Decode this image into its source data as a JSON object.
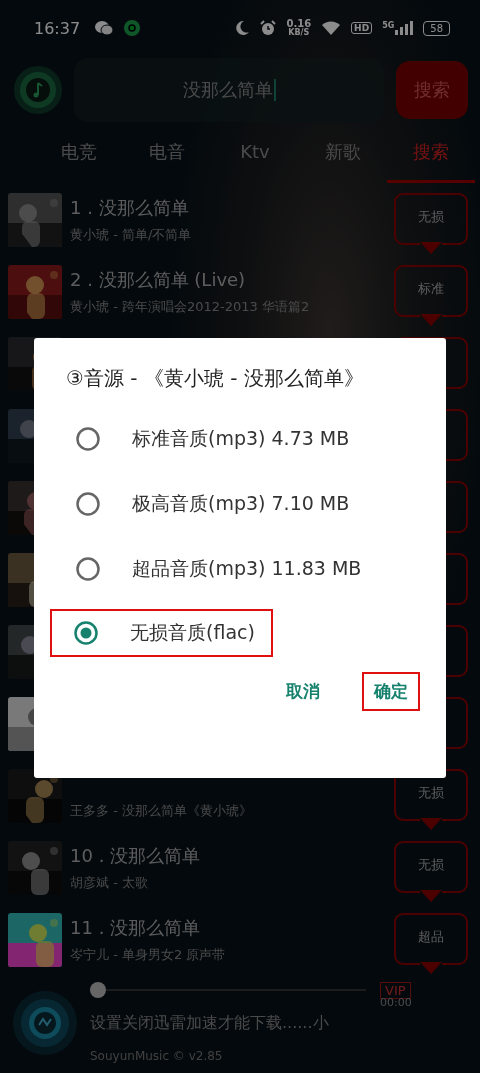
{
  "status_bar": {
    "time": "16:37",
    "speed_value": "0.16",
    "speed_unit": "KB/S",
    "hd": "HD",
    "network": "5G",
    "battery": "58"
  },
  "search": {
    "value": "没那么简单",
    "button": "搜索"
  },
  "tabs": [
    {
      "label": "电竞",
      "selected": false
    },
    {
      "label": "电音",
      "selected": false
    },
    {
      "label": "Ktv",
      "selected": false
    },
    {
      "label": "新歌",
      "selected": false
    },
    {
      "label": "搜索",
      "selected": true
    }
  ],
  "songs": [
    {
      "kind": "song",
      "title": "1 . 没那么简单",
      "subtitle": "黄小琥 - 简单/不简单",
      "quality": "无损"
    },
    {
      "kind": "song",
      "title": "2 . 没那么简单 (Live)",
      "subtitle": "黄小琥 - 跨年演唱会2012-2013 华语篇2",
      "quality": "标准"
    },
    {
      "kind": "covered"
    },
    {
      "kind": "covered"
    },
    {
      "kind": "covered"
    },
    {
      "kind": "covered"
    },
    {
      "kind": "covered"
    },
    {
      "kind": "covered"
    },
    {
      "kind": "song",
      "subtitle": "王多多 - 没那么简单《黄小琥》",
      "quality": "无损"
    },
    {
      "kind": "song",
      "title": "10 . 没那么简单",
      "subtitle": "胡彦斌 - 太歌",
      "quality": "无损"
    },
    {
      "kind": "song",
      "title": "11 . 没那么简单",
      "subtitle": "岑宁儿 - 单身男女2 原声带",
      "quality": "超品"
    }
  ],
  "player": {
    "level": 0,
    "vip": "VIP",
    "time": "00:00",
    "message": "设置关闭迅雷加速才能下载......小",
    "version": "SouyunMusic © v2.85"
  },
  "dialog": {
    "title": "③音源 - 《黄小琥 - 没那么简单》",
    "options": [
      {
        "label": "标准音质(mp3) 4.73 MB",
        "selected": false,
        "highlighted": false
      },
      {
        "label": "极高音质(mp3) 7.10 MB",
        "selected": false,
        "highlighted": false
      },
      {
        "label": "超品音质(mp3) 11.83 MB",
        "selected": false,
        "highlighted": false
      },
      {
        "label": "无损音质(flac)",
        "selected": true,
        "highlighted": true
      }
    ],
    "buttons": [
      {
        "label": "取消",
        "highlighted": false
      },
      {
        "label": "确定",
        "highlighted": true
      }
    ]
  }
}
